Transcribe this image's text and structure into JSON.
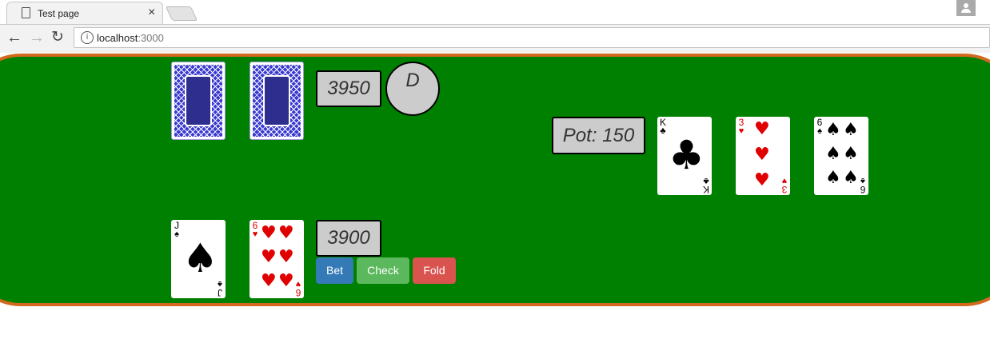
{
  "browser": {
    "tab_title": "Test page",
    "tab_close": "×",
    "url_host": "localhost",
    "url_port": ":3000",
    "info_icon": "i",
    "back_icon": "←",
    "forward_icon": "→",
    "reload_icon": "↻"
  },
  "opponent": {
    "cards": [
      "face-down",
      "face-down"
    ],
    "stack": "3950",
    "dealer_button": "D"
  },
  "pot": "Pot: 150",
  "board": [
    {
      "rank": "K",
      "suit": "♣",
      "color": "#000000"
    },
    {
      "rank": "3",
      "suit": "♥",
      "color": "#e00000"
    },
    {
      "rank": "6",
      "suit": "♠",
      "color": "#000000"
    }
  ],
  "player": {
    "cards": [
      {
        "rank": "J",
        "suit": "♠",
        "color": "#000000"
      },
      {
        "rank": "6",
        "suit": "♥",
        "color": "#e00000"
      }
    ],
    "stack": "3900"
  },
  "actions": {
    "bet": "Bet",
    "check": "Check",
    "fold": "Fold"
  },
  "colors": {
    "felt": "#008000",
    "rail": "#d2691e",
    "chip_box": "#cccccc",
    "bet": "#337ab7",
    "check": "#5cb85c",
    "fold": "#d9534f"
  }
}
